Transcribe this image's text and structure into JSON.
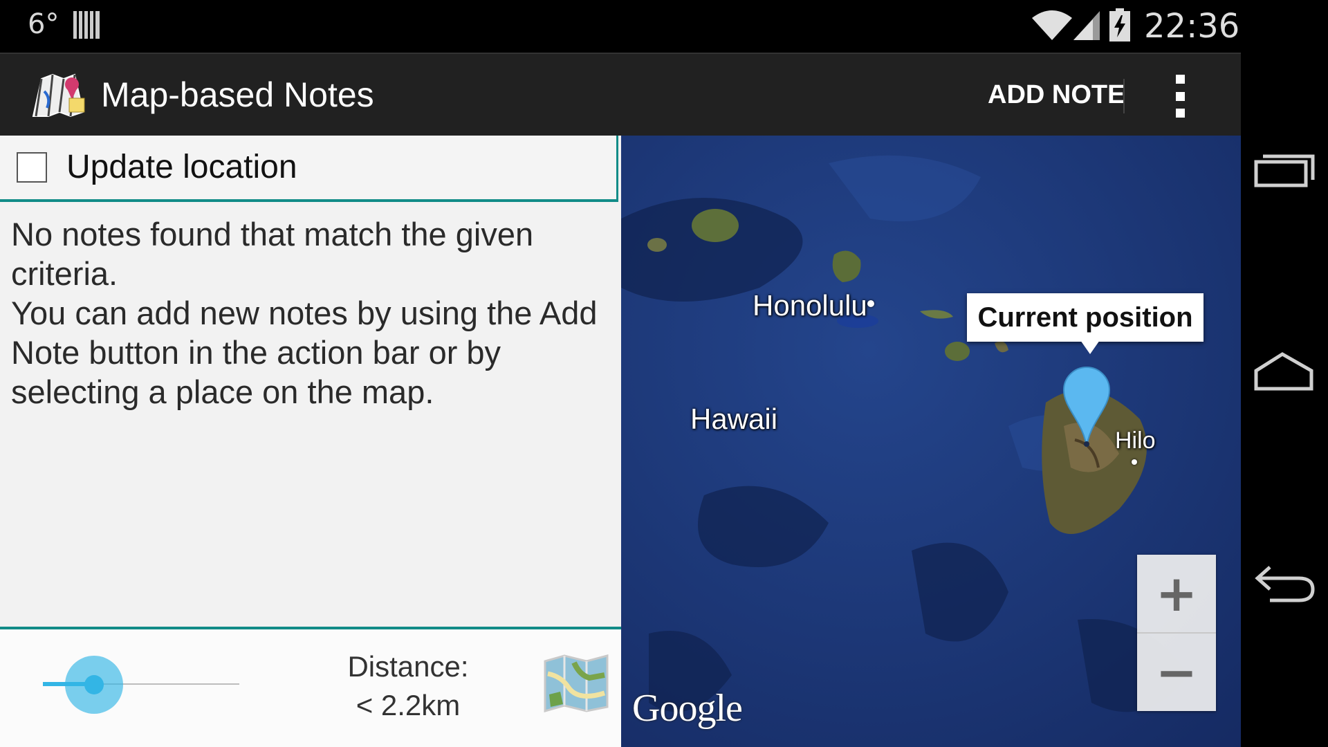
{
  "status_bar": {
    "temperature": "6°",
    "time": "22:36",
    "icons": [
      "barcode-icon",
      "wifi-icon",
      "signal-icon",
      "battery-charging-icon"
    ]
  },
  "action_bar": {
    "app_title": "Map-based Notes",
    "add_note_label": "ADD NOTE",
    "icons": [
      "app-map-icon",
      "overflow-menu-icon"
    ]
  },
  "left_panel": {
    "update_location": {
      "label": "Update location",
      "checked": false
    },
    "notes_message_lines": [
      "No notes found that match the given",
      "criteria.",
      "You can add new notes by using the Add",
      "Note button in the action bar or by",
      "selecting a place on the map."
    ],
    "distance": {
      "label": "Distance:",
      "value": "< 2.2km",
      "slider_fraction": 0.25
    },
    "map_button_icon": "folded-map-icon"
  },
  "map": {
    "labels": {
      "honolulu": "Honolulu",
      "hawaii": "Hawaii",
      "hilo": "Hilo"
    },
    "info_window": "Current position",
    "zoom_in": "+",
    "zoom_out": "−",
    "attribution": "Google",
    "colors": {
      "ocean": "#1e3576",
      "land": "#5a6b3a",
      "marker": "#5bb8f0"
    }
  },
  "nav_bar": {
    "icons": [
      "recent-apps-icon",
      "home-icon",
      "back-icon"
    ]
  },
  "colors": {
    "accent": "#128c88",
    "slider": "#33b5e5",
    "action_bar": "#212121"
  }
}
